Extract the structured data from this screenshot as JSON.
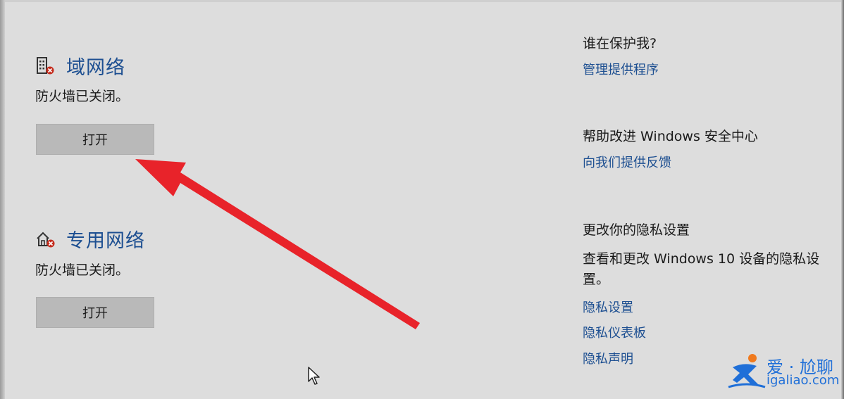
{
  "networks": [
    {
      "icon": "domain-network-building-icon",
      "title": "域网络",
      "status": "防火墙已关闭。",
      "button_label": "打开"
    },
    {
      "icon": "private-network-house-icon",
      "title": "专用网络",
      "status": "防火墙已关闭。",
      "button_label": "打开"
    }
  ],
  "sidebar": {
    "protect": {
      "heading": "谁在保护我?",
      "link": "管理提供程序"
    },
    "improve": {
      "heading": "帮助改进 Windows 安全中心",
      "link": "向我们提供反馈"
    },
    "privacy": {
      "heading": "更改你的隐私设置",
      "description": "查看和更改 Windows 10 设备的隐私设置。",
      "links": [
        "隐私设置",
        "隐私仪表板",
        "隐私声明"
      ]
    }
  },
  "annotation": {
    "arrow_color": "#e8232a"
  },
  "watermark": {
    "line1": "爱 · 尬聊",
    "line2": "igaliao.com"
  },
  "colors": {
    "background": "#dddddd",
    "link": "#1d4f91",
    "button": "#b9b9b9",
    "error_badge": "#c42b1c"
  }
}
